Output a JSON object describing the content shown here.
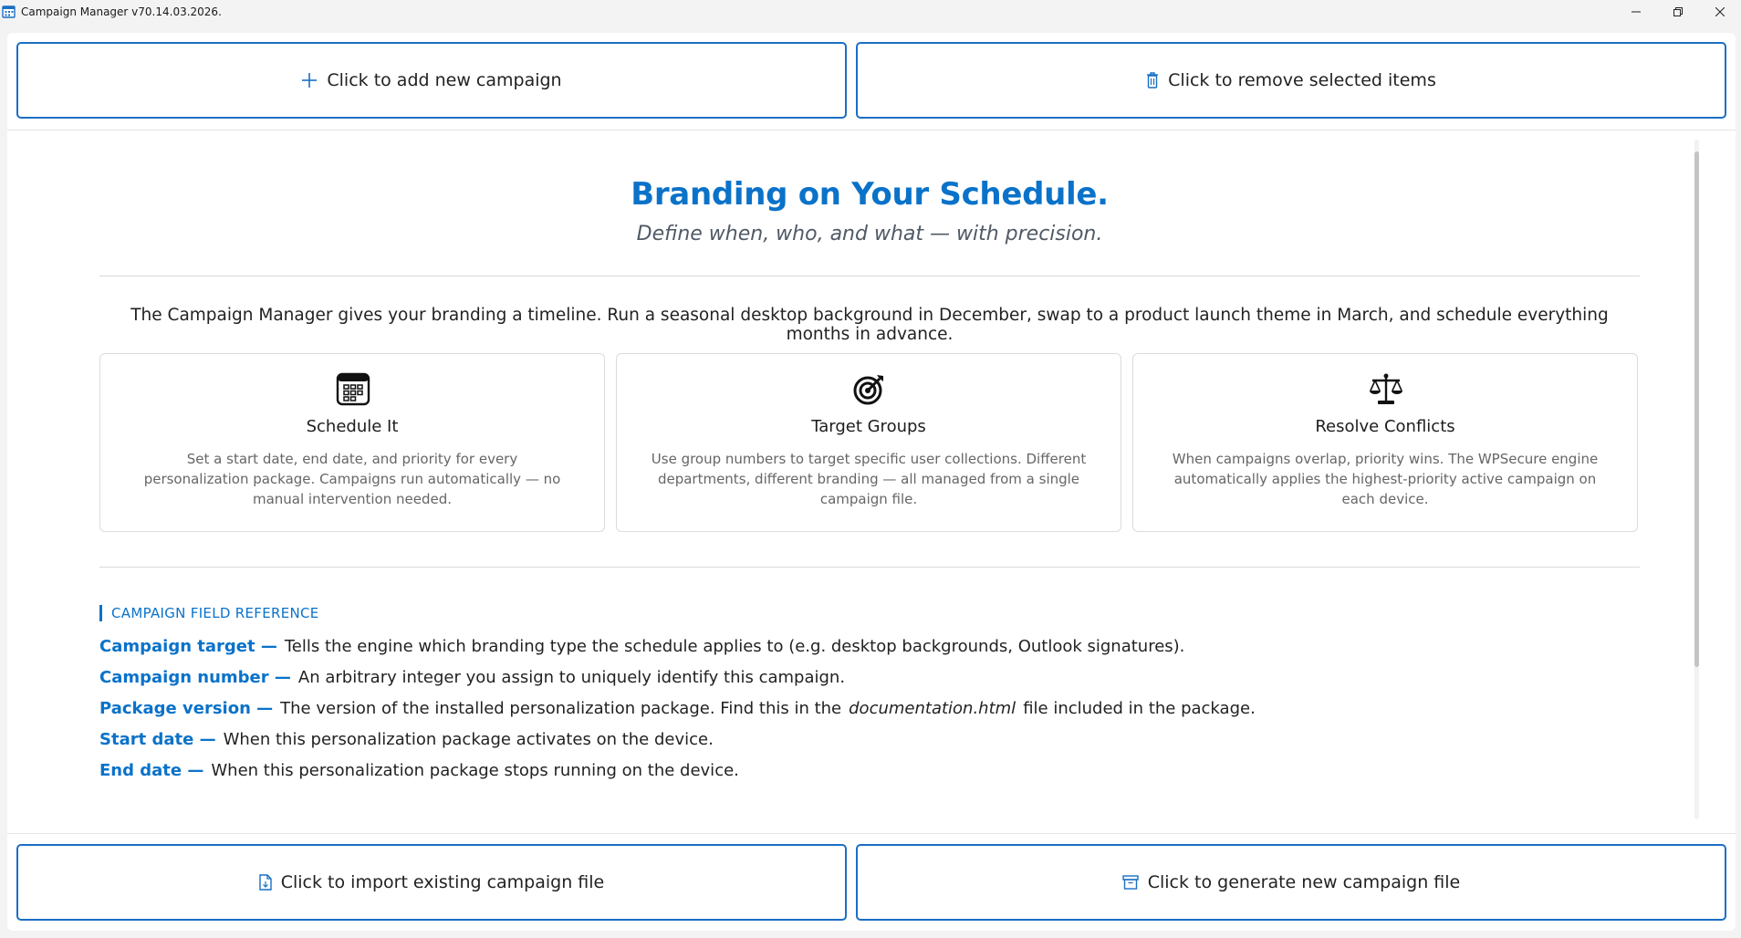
{
  "window": {
    "title": "Campaign Manager v70.14.03.2026."
  },
  "toolbar": {
    "add_label": "Click to add new campaign",
    "remove_label": "Click to remove selected items"
  },
  "footer": {
    "import_label": "Click to import existing campaign file",
    "generate_label": "Click to generate new campaign file"
  },
  "hero": {
    "title": "Branding on Your Schedule.",
    "subtitle": "Define when, who, and what — with precision."
  },
  "intro": "The Campaign Manager gives your branding a timeline. Run a seasonal desktop background in December, swap to a product launch theme in March, and schedule everything months in advance.",
  "cards": [
    {
      "icon": "calendar-icon",
      "title": "Schedule It",
      "description": "Set a start date, end date, and priority for every personalization package. Campaigns run automatically — no manual intervention needed."
    },
    {
      "icon": "target-icon",
      "title": "Target Groups",
      "description": "Use group numbers to target specific user collections. Different departments, different branding — all managed from a single campaign file."
    },
    {
      "icon": "scales-icon",
      "title": "Resolve Conflicts",
      "description": "When campaigns overlap, priority wins. The WPSecure engine automatically applies the highest-priority active campaign on each device."
    }
  ],
  "reference": {
    "header": "CAMPAIGN FIELD REFERENCE",
    "fields": [
      {
        "term": "Campaign target —",
        "text": "Tells the engine which branding type the schedule applies to (e.g. desktop backgrounds, Outlook signatures)."
      },
      {
        "term": "Campaign number —",
        "text": "An arbitrary integer you assign to uniquely identify this campaign."
      },
      {
        "term": "Package version —",
        "text": "The version of the installed personalization package. Find this in the",
        "italic": "documentation.html",
        "text_after": "file included in the package."
      },
      {
        "term": "Start date —",
        "text": "When this personalization package activates on the device."
      },
      {
        "term": "End date —",
        "text": "When this personalization package stops running on the device."
      }
    ]
  },
  "colors": {
    "accent": "#0a72c9",
    "button_border": "#1a6fc4"
  }
}
